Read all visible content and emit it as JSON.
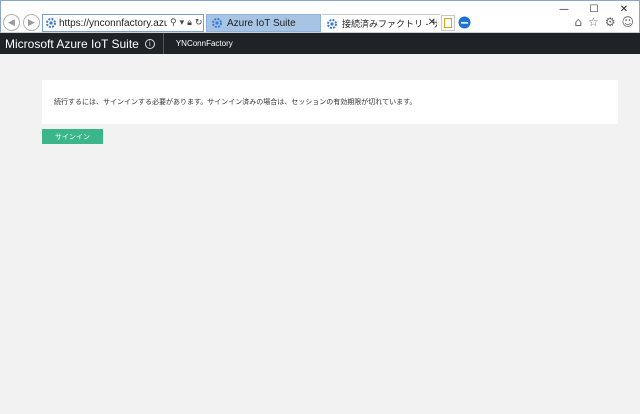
{
  "browser": {
    "address": {
      "url": "https://ynconnfactory.azureweb..."
    },
    "tabs": [
      {
        "label": "Azure IoT Suite"
      },
      {
        "label": "接続済みファクトリ - サインイン"
      }
    ],
    "window_controls": {
      "minimize": "—",
      "maximize": "☐",
      "close": "✕"
    }
  },
  "header": {
    "brand": "Microsoft Azure IoT Suite",
    "solution": "YNConnFactory"
  },
  "main": {
    "message": "続行するには、サインインする必要があります。サインイン済みの場合は、セッションの有効期限が切れています。",
    "signin_label": "サインイン"
  },
  "colors": {
    "header_bg": "#1f2327",
    "signin_button": "#3bb58a",
    "page_bg": "#f2f2f2"
  }
}
